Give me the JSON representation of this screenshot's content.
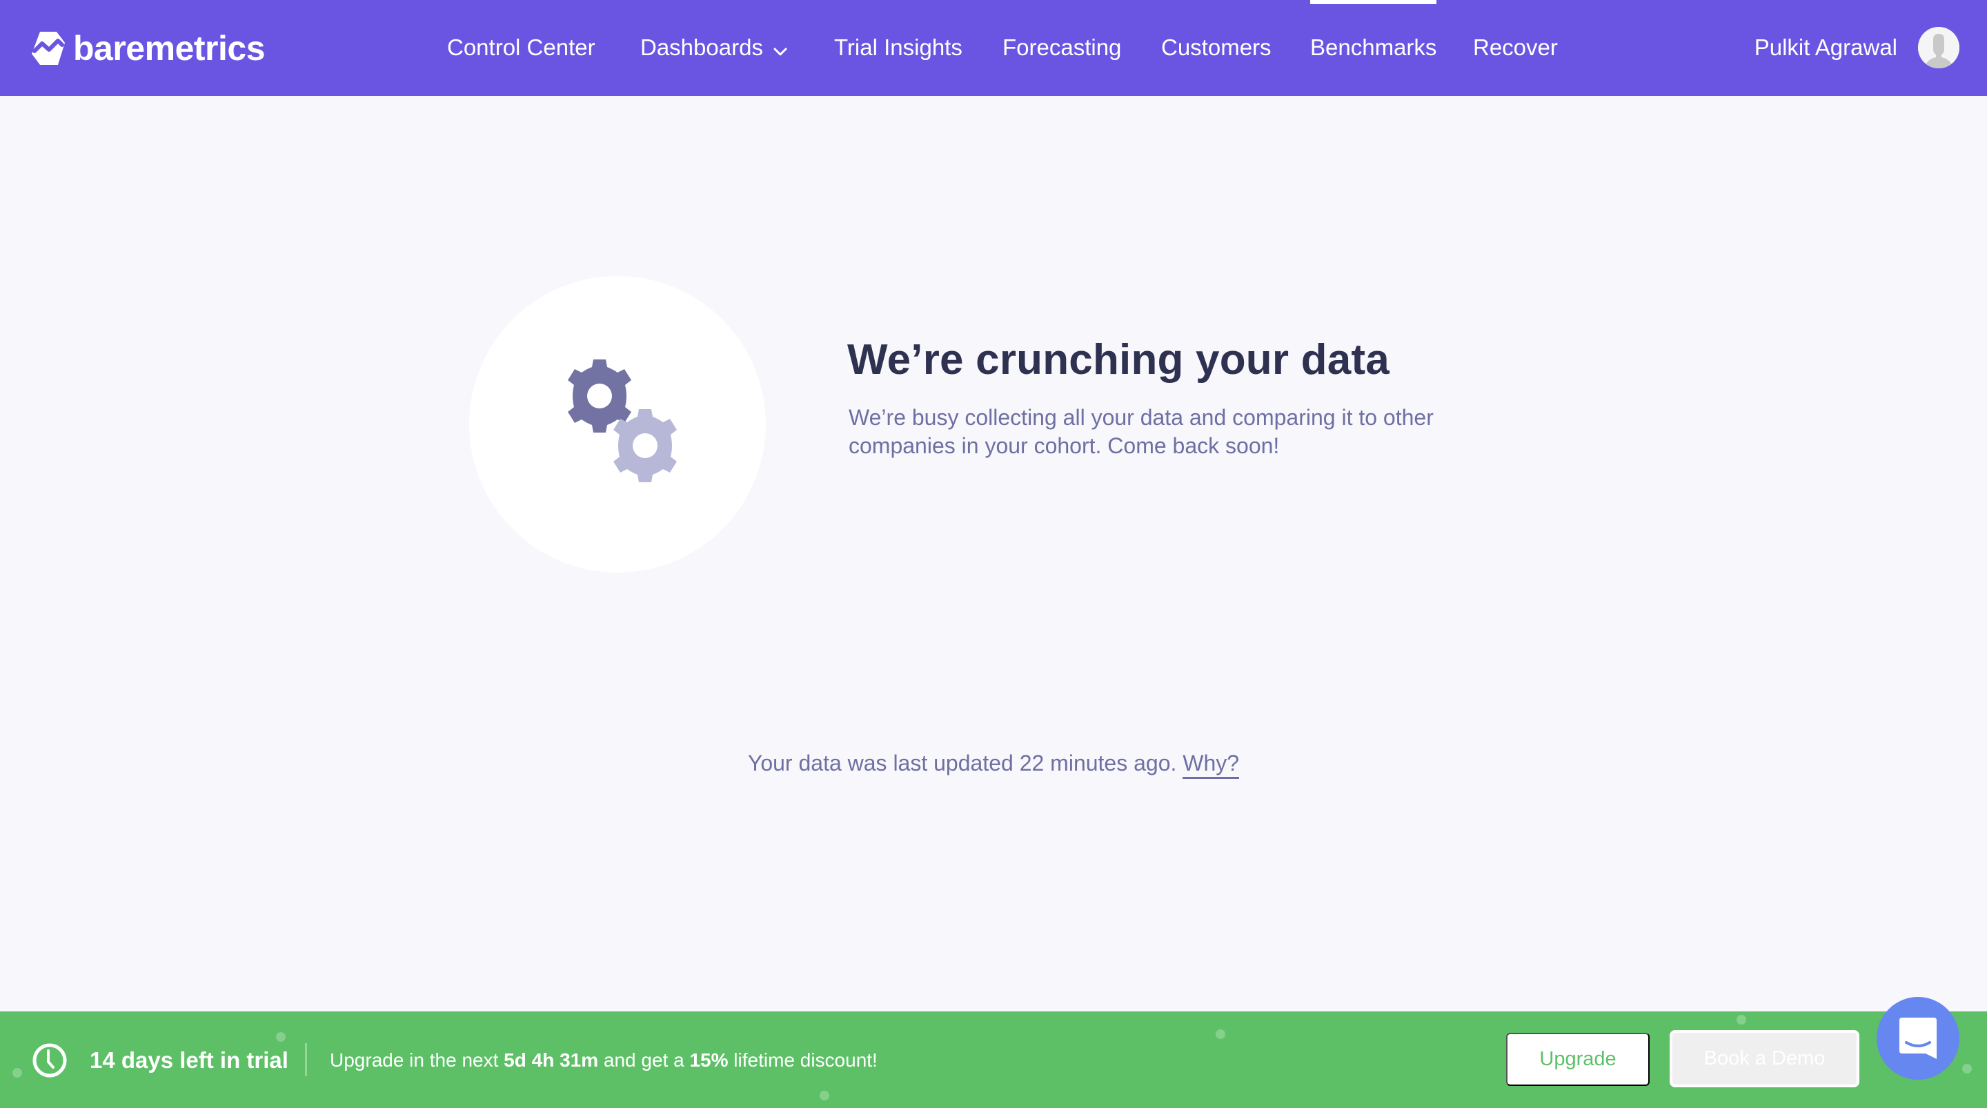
{
  "nav": {
    "brand": "baremetrics",
    "items": [
      {
        "label": "Control Center",
        "active": false
      },
      {
        "label": "Dashboards",
        "active": false,
        "has_dropdown": true
      },
      {
        "label": "Trial Insights",
        "active": false
      },
      {
        "label": "Forecasting",
        "active": false
      },
      {
        "label": "Customers",
        "active": false
      },
      {
        "label": "Benchmarks",
        "active": true
      },
      {
        "label": "Recover",
        "active": false
      }
    ],
    "user_name": "Pulkit Agrawal",
    "avatar_icon": "user-silhouette-icon"
  },
  "main": {
    "illustration_icon": "gears-icon",
    "heading": "We’re crunching your data",
    "subtext": "We’re busy collecting all your data and comparing it to other companies in your cohort. Come back soon!",
    "updated_text": "Your data was last updated 22 minutes ago.",
    "why_link": "Why?"
  },
  "trial_bar": {
    "clock_icon": "clock-icon",
    "days_left": "14 days left in trial",
    "msg_prefix": "Upgrade in the next ",
    "countdown": "5d 4h 31m",
    "msg_middle": " and get a ",
    "discount": "15%",
    "msg_suffix": " lifetime discount!",
    "upgrade_label": "Upgrade",
    "demo_label": "Book a Demo"
  },
  "chat": {
    "icon": "chat-bubble-icon"
  },
  "colors": {
    "nav_bg": "#6A55E2",
    "trial_bg": "#5DC066",
    "heading": "#2E3150",
    "muted_text": "#6E6FA2",
    "gear_dark": "#7272A3",
    "gear_light": "#B7B8D8",
    "chat_bg": "#6587EF",
    "page_bg": "#F7F7FC"
  }
}
